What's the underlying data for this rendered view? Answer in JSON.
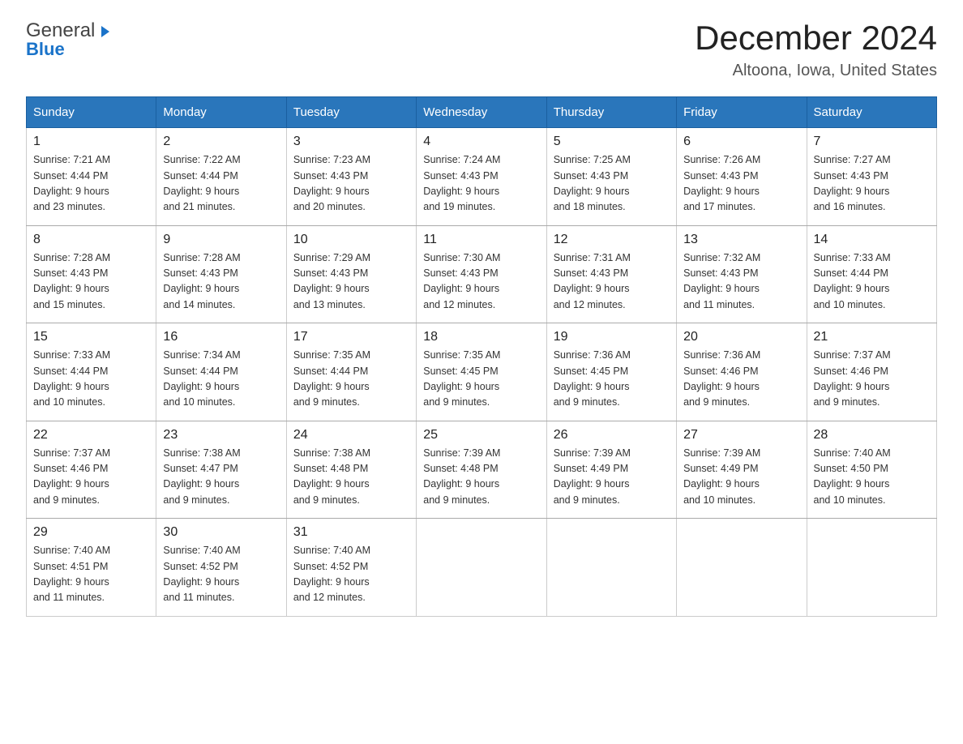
{
  "header": {
    "logo_general": "General",
    "logo_blue": "Blue",
    "main_title": "December 2024",
    "subtitle": "Altoona, Iowa, United States"
  },
  "calendar": {
    "days_of_week": [
      "Sunday",
      "Monday",
      "Tuesday",
      "Wednesday",
      "Thursday",
      "Friday",
      "Saturday"
    ],
    "weeks": [
      [
        {
          "day": "1",
          "sunrise": "7:21 AM",
          "sunset": "4:44 PM",
          "daylight": "9 hours and 23 minutes."
        },
        {
          "day": "2",
          "sunrise": "7:22 AM",
          "sunset": "4:44 PM",
          "daylight": "9 hours and 21 minutes."
        },
        {
          "day": "3",
          "sunrise": "7:23 AM",
          "sunset": "4:43 PM",
          "daylight": "9 hours and 20 minutes."
        },
        {
          "day": "4",
          "sunrise": "7:24 AM",
          "sunset": "4:43 PM",
          "daylight": "9 hours and 19 minutes."
        },
        {
          "day": "5",
          "sunrise": "7:25 AM",
          "sunset": "4:43 PM",
          "daylight": "9 hours and 18 minutes."
        },
        {
          "day": "6",
          "sunrise": "7:26 AM",
          "sunset": "4:43 PM",
          "daylight": "9 hours and 17 minutes."
        },
        {
          "day": "7",
          "sunrise": "7:27 AM",
          "sunset": "4:43 PM",
          "daylight": "9 hours and 16 minutes."
        }
      ],
      [
        {
          "day": "8",
          "sunrise": "7:28 AM",
          "sunset": "4:43 PM",
          "daylight": "9 hours and 15 minutes."
        },
        {
          "day": "9",
          "sunrise": "7:28 AM",
          "sunset": "4:43 PM",
          "daylight": "9 hours and 14 minutes."
        },
        {
          "day": "10",
          "sunrise": "7:29 AM",
          "sunset": "4:43 PM",
          "daylight": "9 hours and 13 minutes."
        },
        {
          "day": "11",
          "sunrise": "7:30 AM",
          "sunset": "4:43 PM",
          "daylight": "9 hours and 12 minutes."
        },
        {
          "day": "12",
          "sunrise": "7:31 AM",
          "sunset": "4:43 PM",
          "daylight": "9 hours and 12 minutes."
        },
        {
          "day": "13",
          "sunrise": "7:32 AM",
          "sunset": "4:43 PM",
          "daylight": "9 hours and 11 minutes."
        },
        {
          "day": "14",
          "sunrise": "7:33 AM",
          "sunset": "4:44 PM",
          "daylight": "9 hours and 10 minutes."
        }
      ],
      [
        {
          "day": "15",
          "sunrise": "7:33 AM",
          "sunset": "4:44 PM",
          "daylight": "9 hours and 10 minutes."
        },
        {
          "day": "16",
          "sunrise": "7:34 AM",
          "sunset": "4:44 PM",
          "daylight": "9 hours and 10 minutes."
        },
        {
          "day": "17",
          "sunrise": "7:35 AM",
          "sunset": "4:44 PM",
          "daylight": "9 hours and 9 minutes."
        },
        {
          "day": "18",
          "sunrise": "7:35 AM",
          "sunset": "4:45 PM",
          "daylight": "9 hours and 9 minutes."
        },
        {
          "day": "19",
          "sunrise": "7:36 AM",
          "sunset": "4:45 PM",
          "daylight": "9 hours and 9 minutes."
        },
        {
          "day": "20",
          "sunrise": "7:36 AM",
          "sunset": "4:46 PM",
          "daylight": "9 hours and 9 minutes."
        },
        {
          "day": "21",
          "sunrise": "7:37 AM",
          "sunset": "4:46 PM",
          "daylight": "9 hours and 9 minutes."
        }
      ],
      [
        {
          "day": "22",
          "sunrise": "7:37 AM",
          "sunset": "4:46 PM",
          "daylight": "9 hours and 9 minutes."
        },
        {
          "day": "23",
          "sunrise": "7:38 AM",
          "sunset": "4:47 PM",
          "daylight": "9 hours and 9 minutes."
        },
        {
          "day": "24",
          "sunrise": "7:38 AM",
          "sunset": "4:48 PM",
          "daylight": "9 hours and 9 minutes."
        },
        {
          "day": "25",
          "sunrise": "7:39 AM",
          "sunset": "4:48 PM",
          "daylight": "9 hours and 9 minutes."
        },
        {
          "day": "26",
          "sunrise": "7:39 AM",
          "sunset": "4:49 PM",
          "daylight": "9 hours and 9 minutes."
        },
        {
          "day": "27",
          "sunrise": "7:39 AM",
          "sunset": "4:49 PM",
          "daylight": "9 hours and 10 minutes."
        },
        {
          "day": "28",
          "sunrise": "7:40 AM",
          "sunset": "4:50 PM",
          "daylight": "9 hours and 10 minutes."
        }
      ],
      [
        {
          "day": "29",
          "sunrise": "7:40 AM",
          "sunset": "4:51 PM",
          "daylight": "9 hours and 11 minutes."
        },
        {
          "day": "30",
          "sunrise": "7:40 AM",
          "sunset": "4:52 PM",
          "daylight": "9 hours and 11 minutes."
        },
        {
          "day": "31",
          "sunrise": "7:40 AM",
          "sunset": "4:52 PM",
          "daylight": "9 hours and 12 minutes."
        },
        null,
        null,
        null,
        null
      ]
    ],
    "labels": {
      "sunrise": "Sunrise:",
      "sunset": "Sunset:",
      "daylight": "Daylight:"
    }
  }
}
